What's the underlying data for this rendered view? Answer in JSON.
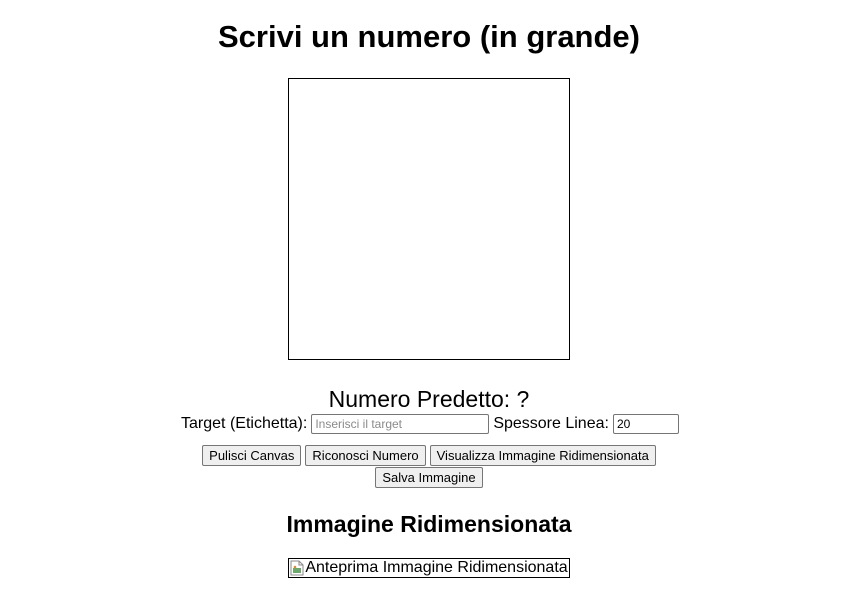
{
  "page": {
    "title": "Scrivi un numero (in grande)"
  },
  "prediction": {
    "text": "Numero Predetto: ?"
  },
  "controls": {
    "target_label": "Target (Etichetta):",
    "target_placeholder": "Inserisci il target",
    "target_value": "",
    "thickness_label": "Spessore Linea:",
    "thickness_value": "20"
  },
  "buttons": {
    "clear": "Pulisci Canvas",
    "recognize": "Riconosci Numero",
    "show_resized": "Visualizza Immagine Ridimensionata",
    "save": "Salva Immagine"
  },
  "resized": {
    "title": "Immagine Ridimensionata",
    "image_alt": "Anteprima Immagine Ridimensionata"
  },
  "icons": {
    "broken_image": "broken-image-icon"
  }
}
